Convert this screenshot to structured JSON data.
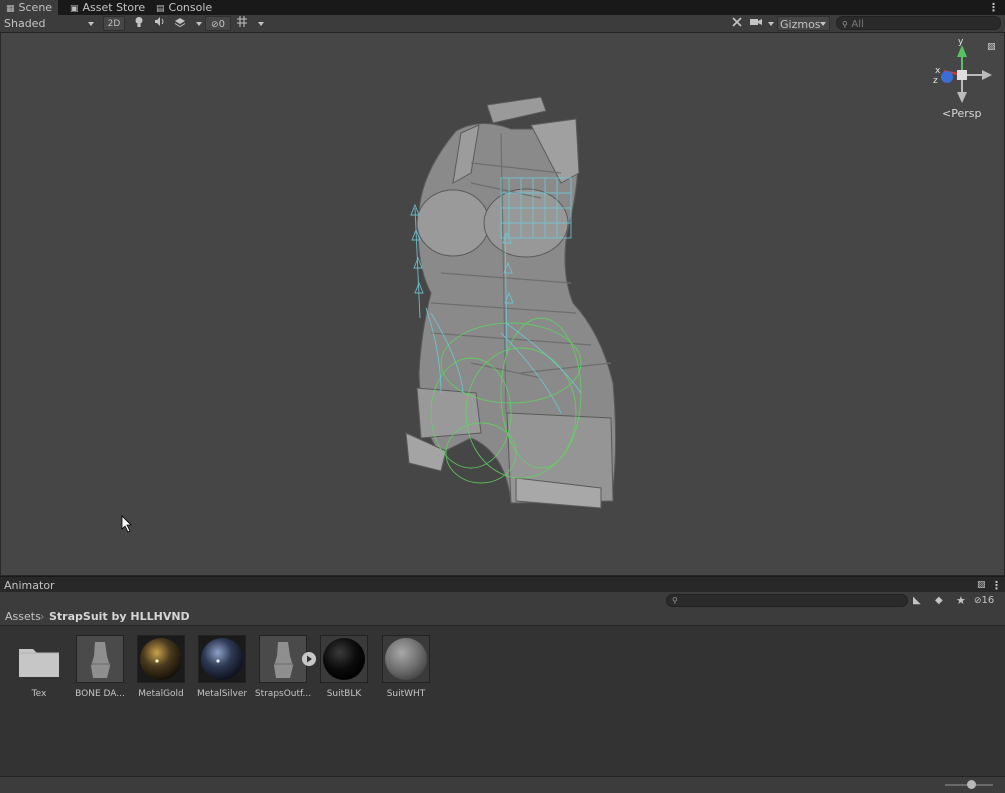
{
  "tabs": [
    {
      "label": "Scene",
      "icon": "hash-icon"
    },
    {
      "label": "Asset Store",
      "icon": "shopping-bag-icon"
    },
    {
      "label": "Console",
      "icon": "console-icon"
    }
  ],
  "scene_toolbar": {
    "shading_mode": "Shaded",
    "mode_2d": "2D",
    "hidden_count": "0",
    "gizmos_label": "Gizmos",
    "search_placeholder": "All"
  },
  "viewport": {
    "projection_label": "Persp",
    "axis_labels": {
      "y": "y",
      "x": "x",
      "z": "z"
    }
  },
  "animator": {
    "title": "Animator"
  },
  "project": {
    "hidden_count": "16",
    "breadcrumb_root": "Assets",
    "breadcrumb_current": "StrapSuit by HLLHVND",
    "assets": [
      {
        "label": "Tex",
        "kind": "folder"
      },
      {
        "label": "BONE DA...",
        "kind": "model"
      },
      {
        "label": "MetalGold",
        "kind": "material-gold"
      },
      {
        "label": "MetalSilver",
        "kind": "material-silver"
      },
      {
        "label": "StrapsOutf...",
        "kind": "model-expandable"
      },
      {
        "label": "SuitBLK",
        "kind": "material-black"
      },
      {
        "label": "SuitWHT",
        "kind": "material-white"
      }
    ]
  },
  "colors": {
    "background": "#282828",
    "toolbar": "#3c3c3c",
    "viewport": "#464646",
    "bone_cyan": "#6ec8d6",
    "collider_green": "#5ed65e"
  }
}
